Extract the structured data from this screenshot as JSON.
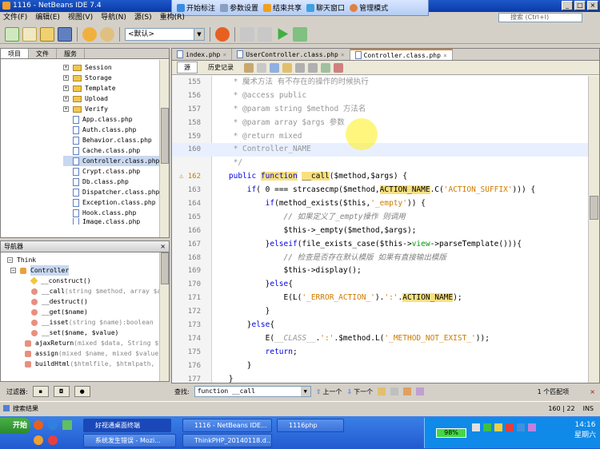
{
  "window": {
    "title": "1116 - NetBeans IDE 7.4",
    "min": "_",
    "max": "□",
    "close": "×"
  },
  "qqbar": {
    "items": [
      "开始标注",
      "参数设置",
      "结束共享",
      "聊天窗口",
      "管理模式"
    ]
  },
  "menu": [
    "文件(F)",
    "编辑(E)",
    "视图(V)",
    "导航(N)",
    "源(S)",
    "重构(R)"
  ],
  "search": {
    "placeholder": "搜索 (Ctrl+I)"
  },
  "toolbar": {
    "config": "<默认>"
  },
  "projects": {
    "tabs": [
      "项目",
      "文件",
      "服务"
    ],
    "folders": [
      "Session",
      "Storage",
      "Template",
      "Upload",
      "Verify"
    ],
    "files": [
      "App.class.php",
      "Auth.class.php",
      "Behavior.class.php",
      "Cache.class.php",
      "Controller.class.php",
      "Crypt.class.php",
      "Db.class.php",
      "Dispatcher.class.php",
      "Exception.class.php",
      "Hook.class.php",
      "Image.class.php"
    ]
  },
  "navigator": {
    "title": "导航器",
    "close": "×",
    "root": "Think",
    "class": "Controller",
    "members": [
      {
        "name": "__construct()",
        "sig": ""
      },
      {
        "name": "__call",
        "sig": "(string $method, array $arg"
      },
      {
        "name": "__destruct()",
        "sig": ""
      },
      {
        "name": "__get($name)",
        "sig": ""
      },
      {
        "name": "__isset",
        "sig": "(string $name):boolean"
      },
      {
        "name": "__set($name, $value)",
        "sig": ""
      },
      {
        "name": "ajaxReturn",
        "sig": "(mixed $data, String $t"
      },
      {
        "name": "assign",
        "sig": "(mixed $name, mixed $value)"
      },
      {
        "name": "buildHtml",
        "sig": "($htmlfile, $htmlpath, s"
      }
    ]
  },
  "filter": {
    "label": "过滤器:"
  },
  "editor": {
    "tabs": [
      "index.php",
      "UserController.class.php",
      "Controller.class.php"
    ],
    "source": "源",
    "history": "历史记录"
  },
  "find": {
    "label": "查找:",
    "value": "function __call",
    "prev": "上一个",
    "next": "下一个",
    "matches": "1 个匹配项"
  },
  "status": {
    "output": "搜索结果",
    "pos": "160 | 22",
    "mode": "INS"
  },
  "taskbar": {
    "start": "开始",
    "tasks": [
      "好视通桌面终端",
      "1116 - NetBeans IDE...",
      "1116php",
      "系统发生错误 - Mozi...",
      "ThinkPHP_20140118.d..."
    ],
    "battery": "98%",
    "time": "14:16",
    "day": "星期六"
  }
}
